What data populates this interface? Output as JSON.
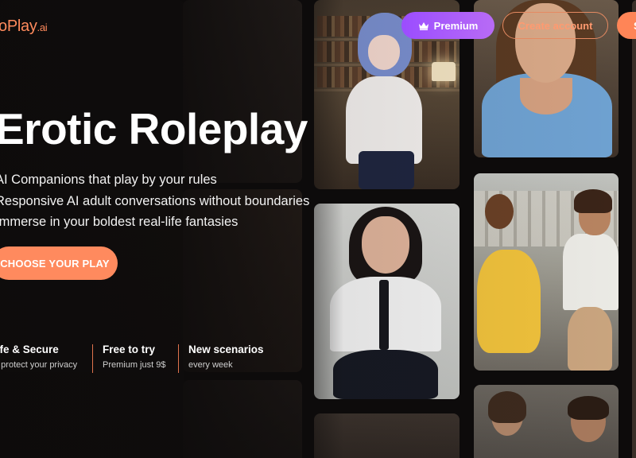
{
  "header": {
    "logo_main": "oPlay",
    "logo_suffix": ".ai",
    "premium_label": "Premium",
    "create_account_label": "Create account",
    "signin_label": "S"
  },
  "hero": {
    "title": "Erotic Roleplay",
    "bullets": [
      "AI Companions that play by your rules",
      "Responsive AI adult conversations without boundaries",
      "Immerse in your boldest real-life fantasies"
    ],
    "cta_label": "CHOOSE YOUR PLAY"
  },
  "features": [
    {
      "title": "afe & Secure",
      "subtitle": "e protect your privacy"
    },
    {
      "title": "Free to try",
      "subtitle": "Premium just 9$"
    },
    {
      "title": "New scenarios",
      "subtitle": "every week"
    }
  ],
  "colors": {
    "accent": "#ff8a5e",
    "premium": "#a857fa",
    "background": "#0d0b0b"
  },
  "icons": {
    "premium": "crown-icon"
  }
}
